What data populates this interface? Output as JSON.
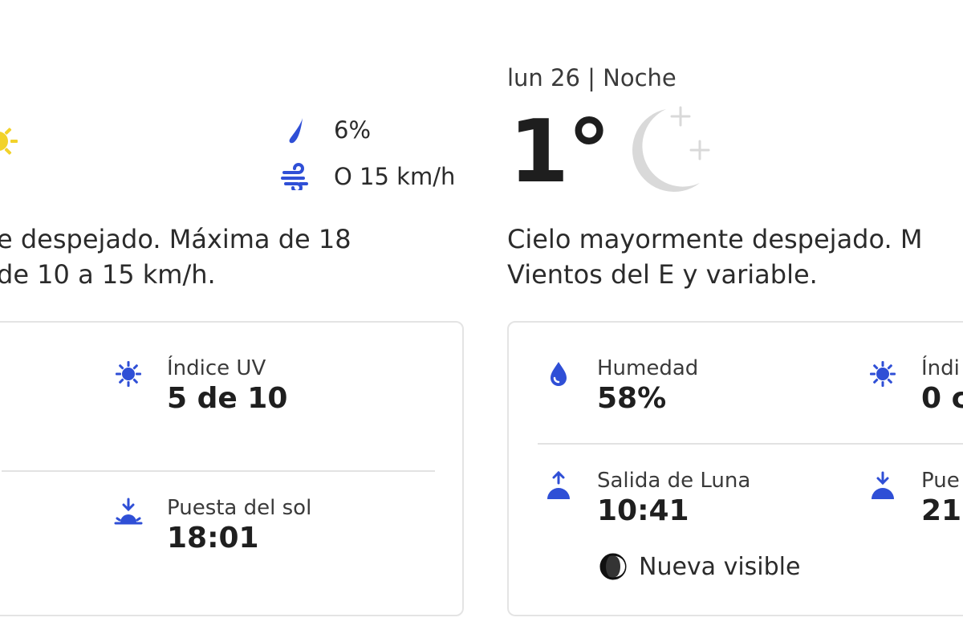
{
  "day": {
    "precip_value": "6%",
    "wind_value": "O 15 km/h",
    "description_line1": "e despejado. Máxima de 18",
    "description_line2": "de 10 a 15 km/h.",
    "details": {
      "uv_label": "Índice UV",
      "uv_value": "5 de 10",
      "sunset_label": "Puesta del sol",
      "sunset_value": "18:01"
    }
  },
  "night": {
    "date_label": "lun 26 | Noche",
    "temperature": "1°",
    "description_line1": "Cielo mayormente despejado. M",
    "description_line2": "Vientos del E y variable.",
    "details": {
      "humidity_label": "Humedad",
      "humidity_value": "58%",
      "uv_label": "Índi",
      "uv_value": "0 c",
      "moonrise_label": "Salida de Luna",
      "moonrise_value": "10:41",
      "moonset_label": "Pue",
      "moonset_value": "21:",
      "moon_phase": "Nueva visible"
    }
  },
  "colors": {
    "accent_blue": "#2f4fd6",
    "sun_yellow": "#f2d22a",
    "moon_gray": "#d9d9d9",
    "border": "#e4e4e4"
  },
  "icons": [
    "sun-icon",
    "raindrop-icon",
    "wind-icon",
    "uv-sun-icon",
    "sunset-icon",
    "humidity-drop-icon",
    "moonrise-icon",
    "moonset-icon",
    "moon-phase-icon",
    "moon-stars-icon"
  ]
}
